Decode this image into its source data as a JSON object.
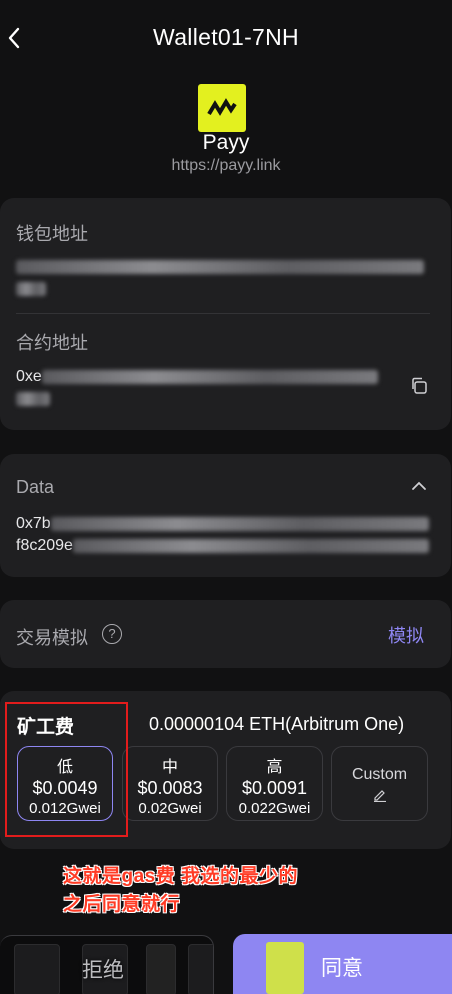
{
  "header": {
    "title": "Wallet01-7NH"
  },
  "dapp": {
    "name": "Payy",
    "url": "https://payy.link"
  },
  "addresses": {
    "wallet_label": "钱包地址",
    "contract_label": "合约地址",
    "contract_prefix": "0xe"
  },
  "data_section": {
    "label": "Data",
    "line1_prefix": "0x7b",
    "line2_prefix": "f8c209e"
  },
  "simulation": {
    "label": "交易模拟",
    "link": "模拟",
    "help_glyph": "?"
  },
  "gas": {
    "title": "矿工费",
    "total": "0.00000104 ETH(Arbitrum One)",
    "options": [
      {
        "tier": "低",
        "price": "$0.0049",
        "gwei": "0.012Gwei",
        "selected": true
      },
      {
        "tier": "中",
        "price": "$0.0083",
        "gwei": "0.02Gwei",
        "selected": false
      },
      {
        "tier": "高",
        "price": "$0.0091",
        "gwei": "0.022Gwei",
        "selected": false
      }
    ],
    "custom_label": "Custom"
  },
  "annotation": {
    "line1": "这就是gas费 我选的最少的",
    "line2": "之后同意就行"
  },
  "actions": {
    "reject": "拒绝",
    "approve": "同意"
  },
  "colors": {
    "accent": "#8e86f2",
    "logo_bg": "#e3f01f",
    "annotation_red": "#ff3b25"
  }
}
